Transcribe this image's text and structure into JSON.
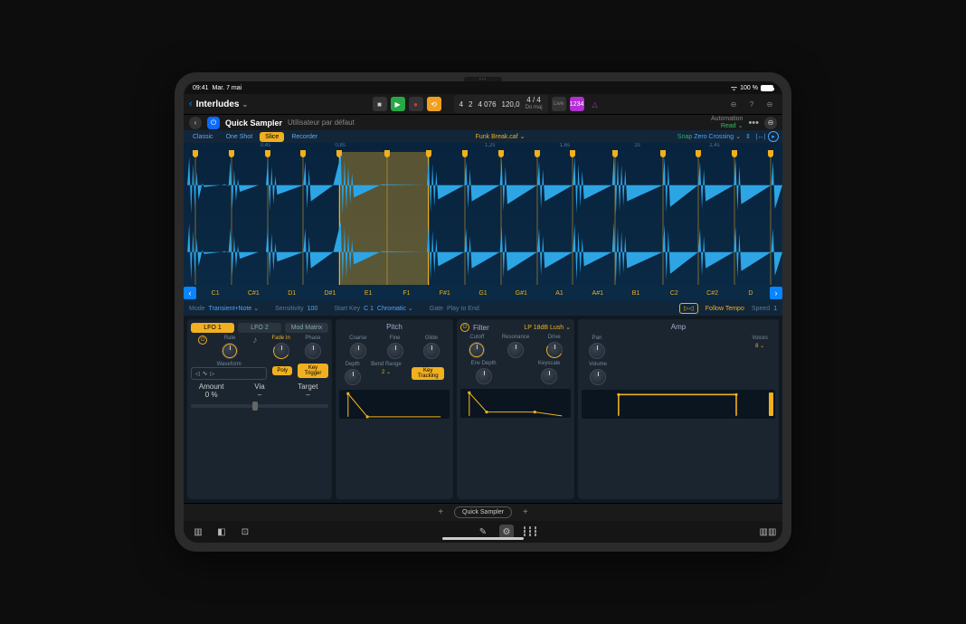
{
  "status": {
    "time": "09:41",
    "date": "Mar. 7 mai",
    "battery": "100 %"
  },
  "project": {
    "name": "Interludes"
  },
  "transport": {
    "bar": "4",
    "beat": "2",
    "position": "4 076",
    "tempo": "120,0",
    "sig": "4 / 4",
    "key": "Do maj",
    "count": "1234"
  },
  "plugin": {
    "title": "Quick Sampler",
    "preset": "Utilisateur par défaut",
    "automation_label": "Automation",
    "automation_mode": "Read"
  },
  "sampler": {
    "tabs": [
      "Classic",
      "One Shot",
      "Slice",
      "Recorder"
    ],
    "active_tab": "Slice",
    "file": "Funk Break.caf",
    "snap_label": "Snap",
    "snap_value": "Zero Crossing",
    "ruler": [
      "",
      "0,4s",
      "0,8s",
      "",
      "1,2s",
      "1,6s",
      "2s",
      "2,4s"
    ],
    "notes": [
      "C1",
      "C#1",
      "D1",
      "D#1",
      "E1",
      "F1",
      "F#1",
      "G1",
      "G#1",
      "A1",
      "A#1",
      "B1",
      "C2",
      "C#2",
      "D"
    ],
    "markers_pct": [
      2,
      8,
      14,
      20,
      26,
      34,
      41,
      47,
      53,
      59,
      65,
      72,
      80,
      86,
      92,
      98
    ],
    "selection_pct": [
      26,
      41
    ],
    "mode_label": "Mode",
    "mode_value": "Transient+Note",
    "sens_label": "Sensitivity",
    "sens_value": "100",
    "startkey_label": "Start Key",
    "startkey_value": "C 1",
    "startkey_type": "Chromatic",
    "gate_label": "Gate",
    "gate_value": "Play to End",
    "follow_tempo": "Follow Tempo",
    "speed_label": "Speed",
    "speed_value": "1"
  },
  "lfo": {
    "tabs": [
      "LFO 1",
      "LFO 2",
      "Mod Matrix"
    ],
    "rate": "Rate",
    "fadein": "Fade In",
    "phase": "Phase",
    "waveform_label": "Waveform",
    "waveform": "∿",
    "poly": "Poly",
    "key_trigger": "Key Trigger",
    "amount_label": "Amount",
    "amount_value": "0 %",
    "via_label": "Via",
    "via_value": "–",
    "target_label": "Target",
    "target_value": "–"
  },
  "pitch": {
    "title": "Pitch",
    "coarse": "Coarse",
    "fine": "Fine",
    "glide": "Glide",
    "depth": "Depth",
    "bend_label": "Bend Range",
    "bend_value": "2",
    "key_tracking": "Key Tracking"
  },
  "filter": {
    "title": "Filter",
    "type": "LP 18dB Lush",
    "cutoff": "Cutoff",
    "reso": "Resonance",
    "drive": "Drive",
    "env_depth": "Env Depth",
    "keyscale": "Keyscale"
  },
  "amp": {
    "title": "Amp",
    "pan": "Pan",
    "voices_label": "Voices",
    "voices_value": "8",
    "volume": "Volume"
  },
  "bottom": {
    "plugin": "Quick Sampler"
  }
}
